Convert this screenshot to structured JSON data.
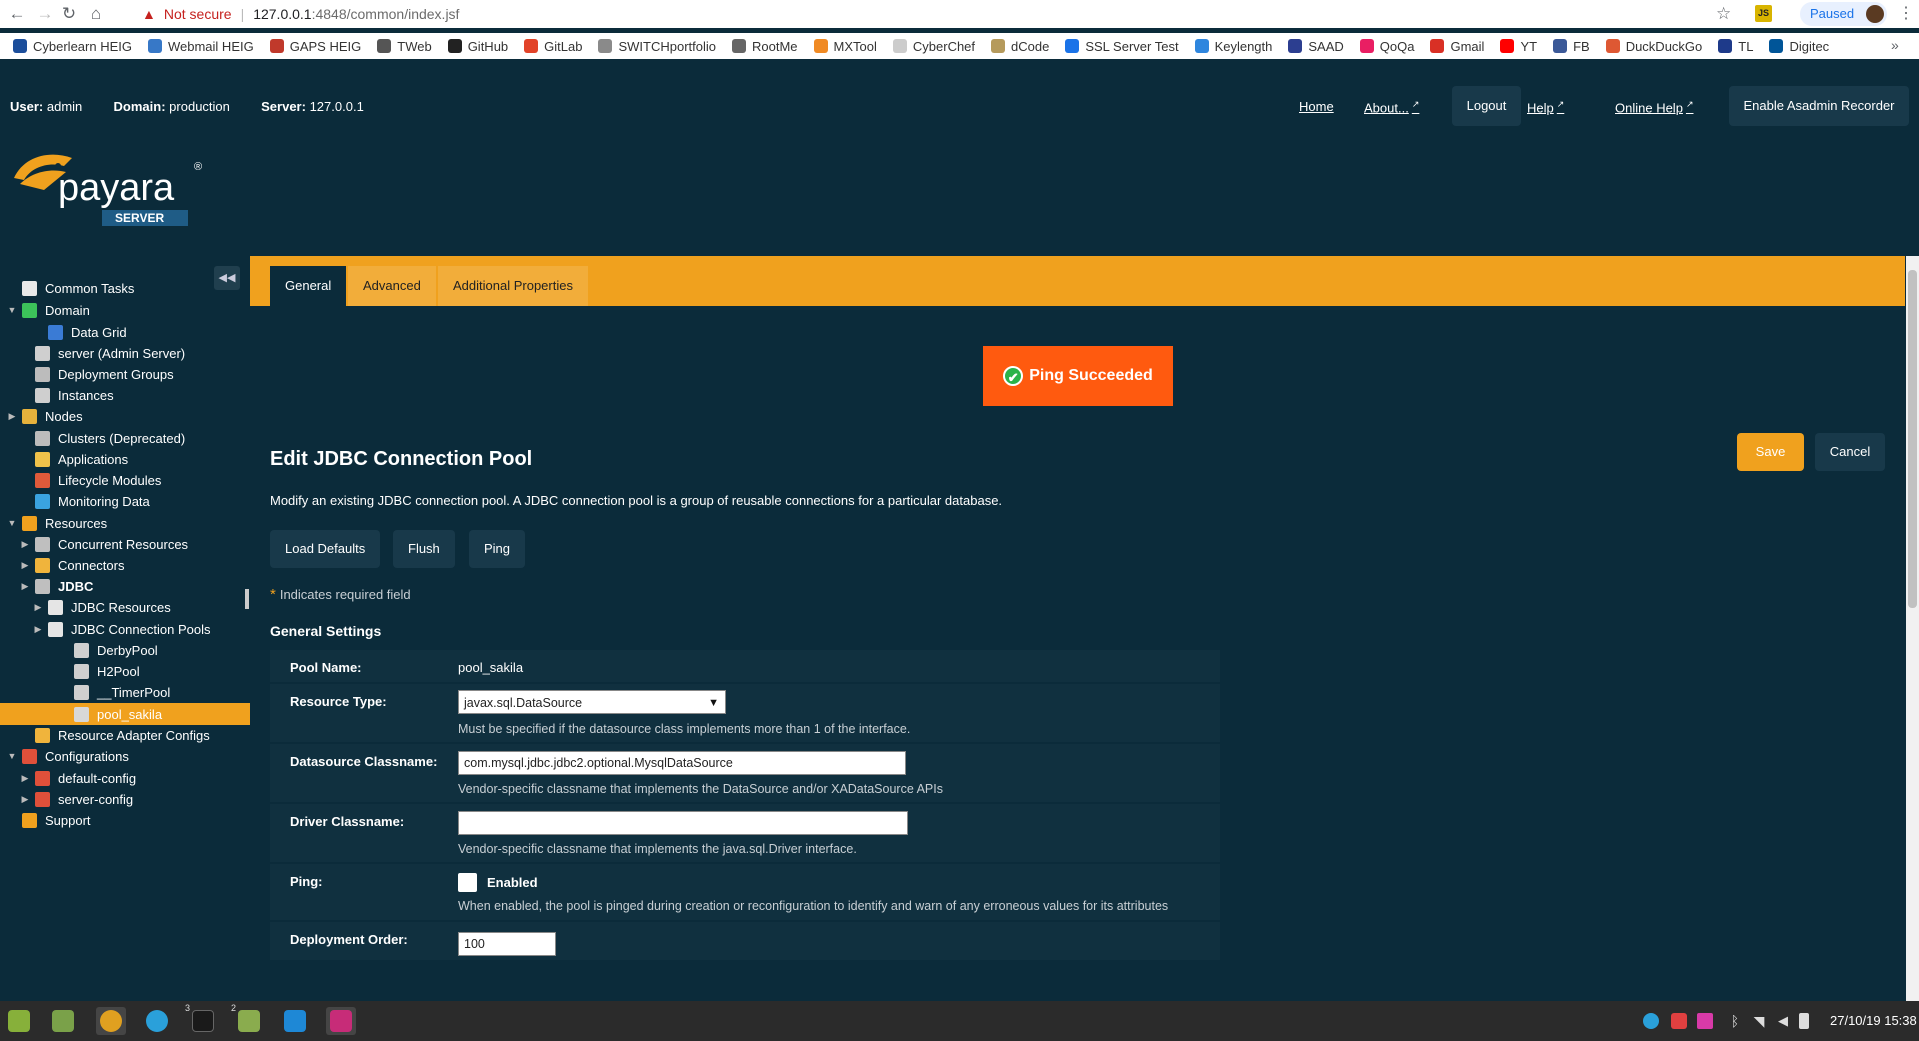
{
  "browser": {
    "security_label": "Not secure",
    "url_host": "127.0.0.1",
    "url_path": ":4848/common/index.jsf",
    "profile_status": "Paused",
    "bookmarks": [
      {
        "label": "Cyberlearn HEIG",
        "color": "#1c4e9b"
      },
      {
        "label": "Webmail HEIG",
        "color": "#3778c7"
      },
      {
        "label": "GAPS HEIG",
        "color": "#c0392b"
      },
      {
        "label": "TWeb",
        "color": "#555555"
      },
      {
        "label": "GitHub",
        "color": "#222222"
      },
      {
        "label": "GitLab",
        "color": "#e24329"
      },
      {
        "label": "SWITCHportfolio",
        "color": "#8a8a8a"
      },
      {
        "label": "RootMe",
        "color": "#666666"
      },
      {
        "label": "MXTool",
        "color": "#f08a24"
      },
      {
        "label": "CyberChef",
        "color": "#cccccc"
      },
      {
        "label": "dCode",
        "color": "#b59a5c"
      },
      {
        "label": "SSL Server Test",
        "color": "#1a73e8"
      },
      {
        "label": "Keylength",
        "color": "#2e86de"
      },
      {
        "label": "SAAD",
        "color": "#2c3e90"
      },
      {
        "label": "QoQa",
        "color": "#e91e63"
      },
      {
        "label": "Gmail",
        "color": "#d93025"
      },
      {
        "label": "YT",
        "color": "#ff0000"
      },
      {
        "label": "FB",
        "color": "#3b5998"
      },
      {
        "label": "DuckDuckGo",
        "color": "#de5833"
      },
      {
        "label": "TL",
        "color": "#1e3a8a"
      },
      {
        "label": "Digitec",
        "color": "#005598"
      }
    ]
  },
  "header": {
    "user_label": "User:",
    "user_value": "admin",
    "domain_label": "Domain:",
    "domain_value": "production",
    "server_label": "Server:",
    "server_value": "127.0.0.1",
    "links": {
      "home": "Home",
      "about": "About...",
      "logout": "Logout",
      "help": "Help",
      "online_help": "Online Help",
      "recorder": "Enable Asadmin Recorder"
    },
    "logo_text": "payara",
    "logo_badge": "SERVER"
  },
  "sidebar": {
    "items": [
      {
        "label": "Common Tasks",
        "icon": "common-tasks-icon"
      },
      {
        "label": "Domain",
        "icon": "domain-icon"
      },
      {
        "label": "Data Grid",
        "icon": "data-grid-icon"
      },
      {
        "label": "server (Admin Server)",
        "icon": "server-icon"
      },
      {
        "label": "Deployment Groups",
        "icon": "deployment-groups-icon"
      },
      {
        "label": "Instances",
        "icon": "instances-icon"
      },
      {
        "label": "Nodes",
        "icon": "nodes-icon"
      },
      {
        "label": "Clusters (Deprecated)",
        "icon": "clusters-icon"
      },
      {
        "label": "Applications",
        "icon": "applications-icon"
      },
      {
        "label": "Lifecycle Modules",
        "icon": "lifecycle-icon"
      },
      {
        "label": "Monitoring Data",
        "icon": "monitoring-icon"
      },
      {
        "label": "Resources",
        "icon": "resources-icon"
      },
      {
        "label": "Concurrent Resources",
        "icon": "database-icon"
      },
      {
        "label": "Connectors",
        "icon": "connector-icon"
      },
      {
        "label": "JDBC",
        "icon": "database-icon"
      },
      {
        "label": "JDBC Resources",
        "icon": "folder-icon"
      },
      {
        "label": "JDBC Connection Pools",
        "icon": "folder-icon"
      },
      {
        "label": "DerbyPool",
        "icon": "database-icon"
      },
      {
        "label": "H2Pool",
        "icon": "database-icon"
      },
      {
        "label": "__TimerPool",
        "icon": "database-icon"
      },
      {
        "label": "pool_sakila",
        "icon": "database-icon"
      },
      {
        "label": "Resource Adapter Configs",
        "icon": "connector-icon"
      },
      {
        "label": "Configurations",
        "icon": "configurations-icon"
      },
      {
        "label": "default-config",
        "icon": "config-icon"
      },
      {
        "label": "server-config",
        "icon": "config-icon"
      },
      {
        "label": "Support",
        "icon": "support-icon"
      }
    ]
  },
  "tabs": [
    "General",
    "Advanced",
    "Additional Properties"
  ],
  "banner": "Ping Succeeded",
  "page": {
    "title": "Edit JDBC Connection Pool",
    "description": "Modify an existing JDBC connection pool. A JDBC connection pool is a group of reusable connections for a particular database.",
    "buttons": {
      "load_defaults": "Load Defaults",
      "flush": "Flush",
      "ping": "Ping",
      "save": "Save",
      "cancel": "Cancel"
    },
    "required_note": "Indicates required field",
    "section_title": "General Settings"
  },
  "form": {
    "pool_name_label": "Pool Name:",
    "pool_name_value": "pool_sakila",
    "resource_type_label": "Resource Type:",
    "resource_type_value": "javax.sql.DataSource",
    "resource_type_help": "Must be specified if the datasource class implements more than 1 of the interface.",
    "datasource_label": "Datasource Classname:",
    "datasource_value": "com.mysql.jdbc.jdbc2.optional.MysqlDataSource",
    "datasource_help": "Vendor-specific classname that implements the DataSource and/or XADataSource APIs",
    "driver_label": "Driver Classname:",
    "driver_value": "",
    "driver_help": "Vendor-specific classname that implements the java.sql.Driver interface.",
    "ping_label": "Ping:",
    "ping_checkbox_label": "Enabled",
    "ping_enabled": false,
    "ping_help": "When enabled, the pool is pinged during creation or reconfiguration to identify and warn of any erroneous values for its attributes",
    "deploy_order_label": "Deployment Order:",
    "deploy_order_value": "100"
  },
  "taskbar": {
    "clock": "27/10/19 15:38",
    "terminal_badge_1": "3",
    "terminal_badge_2": "2"
  }
}
